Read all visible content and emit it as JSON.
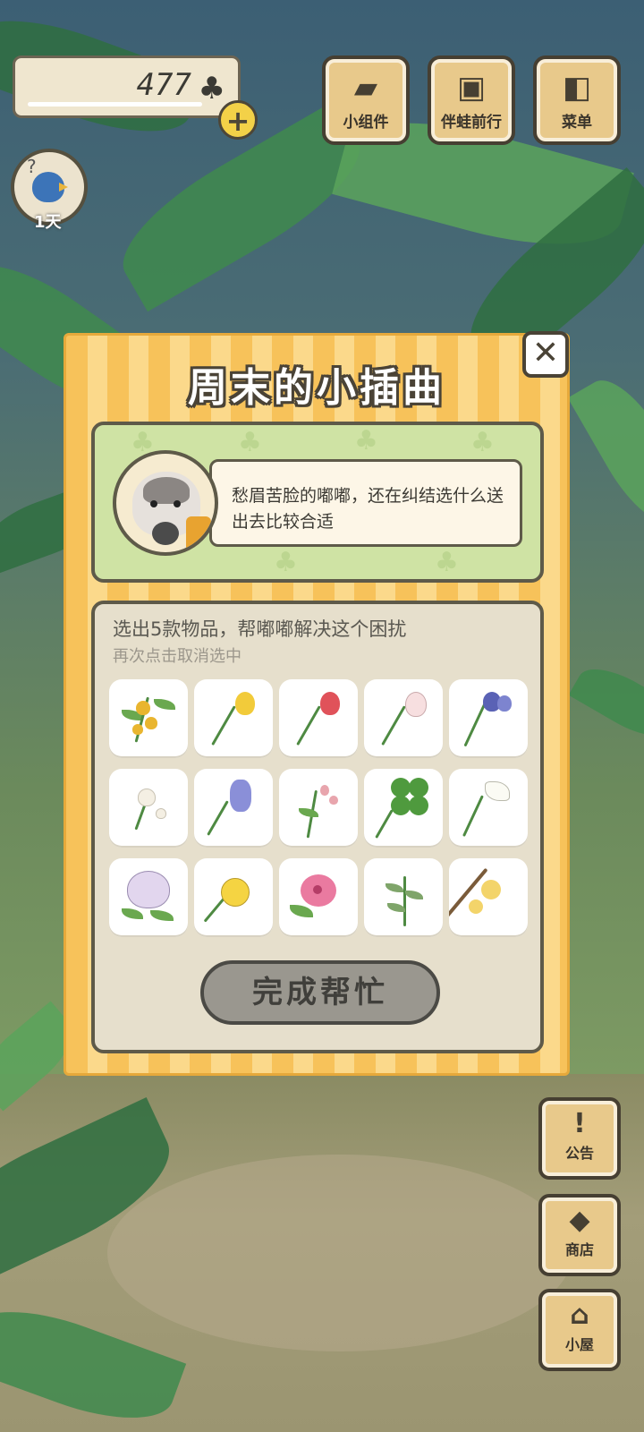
{
  "hud": {
    "clover_count": "477",
    "clover_icon": "clover-icon",
    "plus_label": "+",
    "day_label": "1天"
  },
  "top_buttons": [
    {
      "label": "小组件",
      "icon": "widget-icon"
    },
    {
      "label": "伴蛙前行",
      "icon": "map-icon"
    },
    {
      "label": "菜单",
      "icon": "menu-icon"
    }
  ],
  "dialog": {
    "title": "周末的小插曲",
    "close": "✕",
    "story": "愁眉苦脸的嘟嘟，还在纠结选什么送出去比较合适",
    "instruction": "选出5款物品，帮嘟嘟解决这个困扰",
    "sub_instruction": "再次点击取消选中",
    "items": [
      {
        "name": "osmanthus"
      },
      {
        "name": "yellow-tulip"
      },
      {
        "name": "red-tulip"
      },
      {
        "name": "white-tulip"
      },
      {
        "name": "iris"
      },
      {
        "name": "dandelion"
      },
      {
        "name": "hyacinth"
      },
      {
        "name": "pink-sprig"
      },
      {
        "name": "four-leaf-clover"
      },
      {
        "name": "lily"
      },
      {
        "name": "lilac"
      },
      {
        "name": "buttercup"
      },
      {
        "name": "pink-hibiscus"
      },
      {
        "name": "green-herb"
      },
      {
        "name": "wintersweet"
      }
    ],
    "done_label": "完成帮忙"
  },
  "side_buttons": [
    {
      "label": "公告",
      "icon": "exclamation-icon"
    },
    {
      "label": "商店",
      "icon": "bag-icon"
    },
    {
      "label": "小屋",
      "icon": "house-icon"
    }
  ]
}
